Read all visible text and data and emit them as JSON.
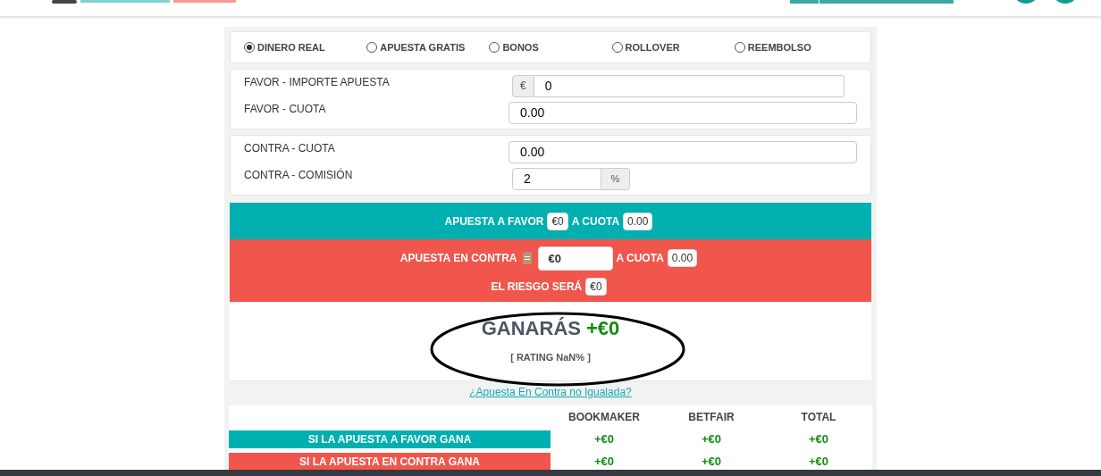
{
  "bet_types": [
    {
      "label": "DINERO REAL",
      "selected": true
    },
    {
      "label": "APUESTA GRATIS",
      "selected": false
    },
    {
      "label": "BONOS",
      "selected": false
    },
    {
      "label": "ROLLOVER",
      "selected": false
    },
    {
      "label": "REEMBOLSO",
      "selected": false
    }
  ],
  "favor_fields": [
    {
      "label": "FAVOR - IMPORTE APUESTA",
      "value": "0",
      "prefix": "€"
    },
    {
      "label": "FAVOR - CUOTA",
      "value": "0.00"
    }
  ],
  "contra_fields": [
    {
      "label": "CONTRA - CUOTA",
      "value": "0.00"
    },
    {
      "label": "CONTRA - COMISIÓN",
      "value": "2",
      "suffix": "%"
    }
  ],
  "favor_band": {
    "label": "APUESTA A FAVOR",
    "amount": "€0",
    "odds_label": "A CUOTA",
    "odds": "0.00"
  },
  "contra_band": {
    "label": "APUESTA EN CONTRA",
    "amount": "€0",
    "odds_label": "A CUOTA",
    "odds": "0.00",
    "risk_label": "EL RIESGO SERÁ",
    "risk": "€0"
  },
  "result": {
    "label": "GANARÁS",
    "amount": "+€0",
    "rating": "[ RATING NaN% ]"
  },
  "link": "¿Apuesta En Contra no Igualada?",
  "table": {
    "columns": [
      "BOOKMAKER",
      "BETFAIR",
      "TOTAL"
    ],
    "rows": [
      {
        "label": "SI LA APUESTA A FAVOR GANA",
        "color": "#00afaf",
        "values": [
          "+€0",
          "+€0",
          "+€0"
        ]
      },
      {
        "label": "SI LA APUESTA EN CONTRA GANA",
        "color": "#f0564c",
        "values": [
          "+€0",
          "+€0",
          "+€0"
        ]
      }
    ]
  }
}
